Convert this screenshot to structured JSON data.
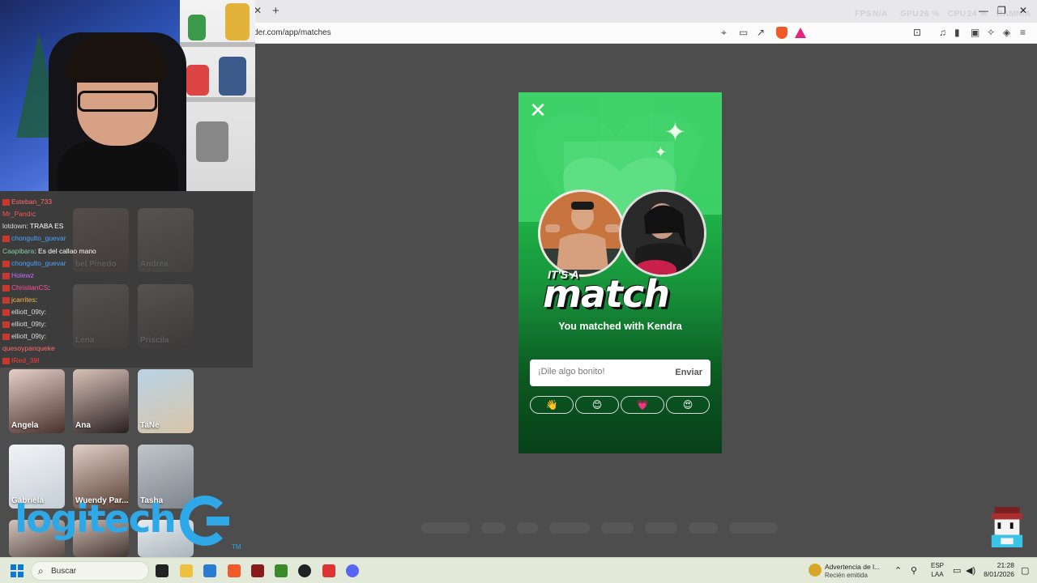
{
  "browser": {
    "url": "der.com/app/matches",
    "perf": [
      "FPS",
      "N/A",
      "GPU",
      "26 %",
      "CPU",
      "24 %",
      "RAM",
      "N/A"
    ]
  },
  "chat": {
    "lines": [
      {
        "user": "Esteban_733",
        "msg": "",
        "color": "#ff6a6a"
      },
      {
        "user": "Mr_Pandx",
        "msg": ":",
        "color": "#ff5252"
      },
      {
        "user": "lotdown",
        "msg": ": TRABA ES",
        "color": "#dcdcdc"
      },
      {
        "user": "chongulto_guevar",
        "msg": "",
        "color": "#4aa3ff"
      },
      {
        "user": "Caapibara",
        "msg": ": Es del callao mano",
        "color": "#7fd0a0"
      },
      {
        "user": "chongulto_guevar",
        "msg": "",
        "color": "#4aa3ff"
      },
      {
        "user": "Holewz",
        "msg": "",
        "color": "#c86bff"
      },
      {
        "user": "ChristianCS",
        "msg": ":",
        "color": "#ff4f9a"
      },
      {
        "user": "jcarrites",
        "msg": ":",
        "color": "#ffb347"
      },
      {
        "user": "elliott_09ty",
        "msg": ":",
        "color": "#dcdcdc"
      },
      {
        "user": "elliott_09ty",
        "msg": ":",
        "color": "#dcdcdc"
      },
      {
        "user": "elliott_09ty",
        "msg": ":",
        "color": "#dcdcdc"
      },
      {
        "user": "quesoypanqueke",
        "msg": "",
        "color": "#ff6a6a"
      },
      {
        "user": "IRed_39I",
        "msg": "",
        "color": "#ff3b3b"
      }
    ]
  },
  "matches": {
    "cards": [
      {
        "name": "bel Pinedo"
      },
      {
        "name": "Andrea"
      },
      {
        "name": "Lena"
      },
      {
        "name": "Priscila"
      },
      {
        "name": "Angela"
      },
      {
        "name": "Ana"
      },
      {
        "name": "TaNe"
      },
      {
        "name": "Gabriela"
      },
      {
        "name": "Wuendy Par..."
      },
      {
        "name": "Tasha"
      }
    ]
  },
  "overlay": {
    "logitech": "logitech",
    "tm": "TM"
  },
  "modal": {
    "its_a": "IT'S A",
    "match_word": "match",
    "matched_text": "You matched with Kendra",
    "input_placeholder": "¡Dile algo bonito!",
    "send_label": "Enviar",
    "emojis": [
      "👋",
      "😊",
      "💗",
      "😍"
    ]
  },
  "taskbar": {
    "search_label": "Buscar",
    "notification_title": "Advertencia de l...",
    "notification_sub": "Recién emitida",
    "lang_line1": "ESP",
    "lang_line2": "LAA",
    "time": "21:28",
    "date": "8/01/2026"
  },
  "colors": {
    "accent_green": "#1fb84a",
    "logitech_blue": "#2fa8e8"
  }
}
